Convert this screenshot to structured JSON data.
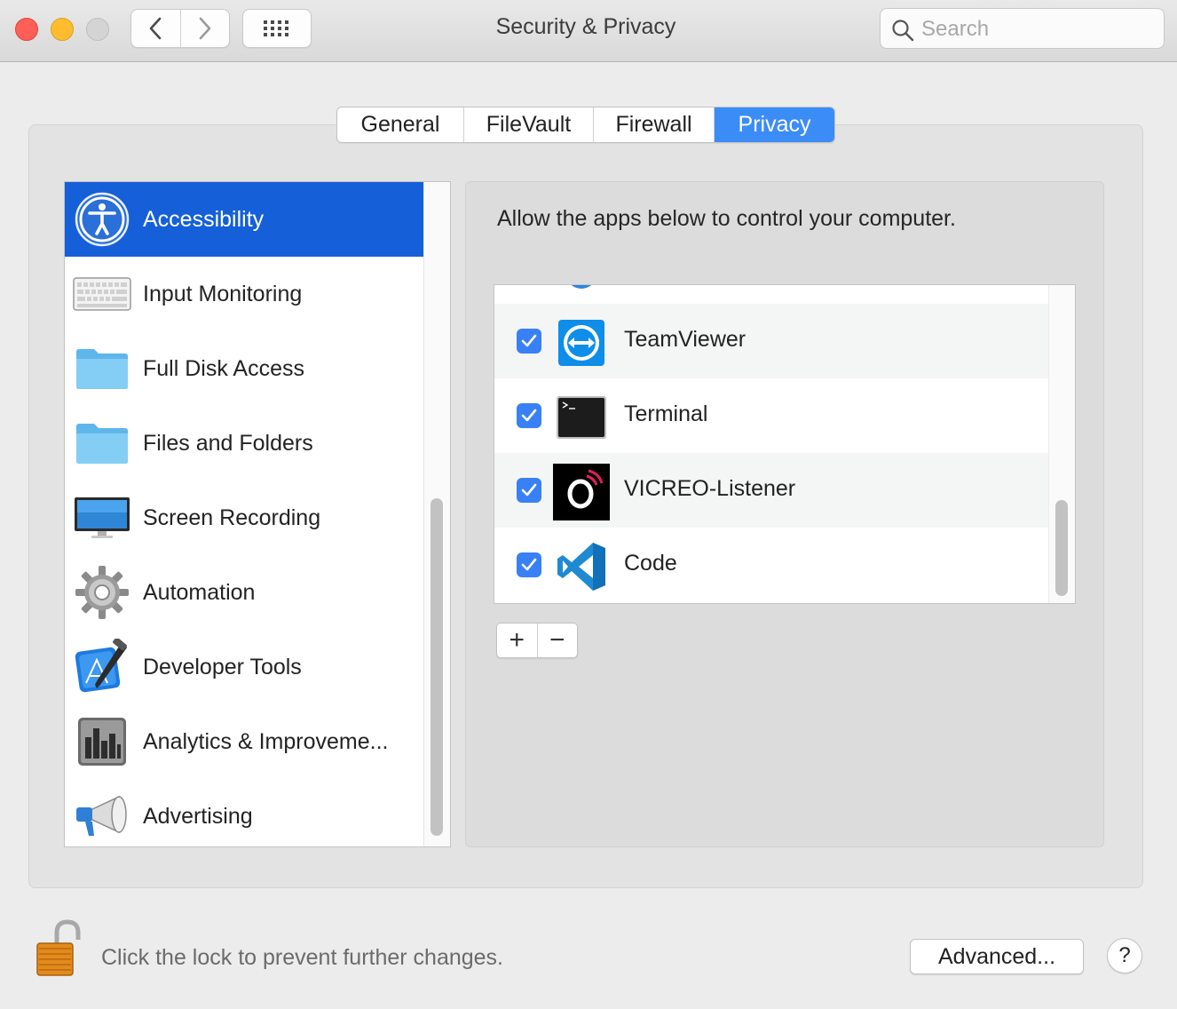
{
  "window": {
    "title": "Security & Privacy"
  },
  "toolbar": {
    "search_placeholder": "Search"
  },
  "tabs": [
    {
      "label": "General",
      "active": false
    },
    {
      "label": "FileVault",
      "active": false
    },
    {
      "label": "Firewall",
      "active": false
    },
    {
      "label": "Privacy",
      "active": true
    }
  ],
  "sidebar": {
    "items": [
      {
        "label": "Accessibility",
        "icon": "accessibility-icon",
        "selected": true
      },
      {
        "label": "Input Monitoring",
        "icon": "keyboard-icon"
      },
      {
        "label": "Full Disk Access",
        "icon": "folder-icon"
      },
      {
        "label": "Files and Folders",
        "icon": "folder-icon"
      },
      {
        "label": "Screen Recording",
        "icon": "display-icon"
      },
      {
        "label": "Automation",
        "icon": "gear-icon"
      },
      {
        "label": "Developer Tools",
        "icon": "xcode-icon"
      },
      {
        "label": "Analytics & Improveme...",
        "icon": "bar-chart-icon"
      },
      {
        "label": "Advertising",
        "icon": "megaphone-icon"
      }
    ]
  },
  "panel": {
    "instruction": "Allow the apps below to control your computer.",
    "apps": [
      {
        "name": "TeamViewer",
        "checked": true,
        "icon": "teamviewer-icon"
      },
      {
        "name": "Terminal",
        "checked": true,
        "icon": "terminal-icon"
      },
      {
        "name": "VICREO-Listener",
        "checked": true,
        "icon": "vicreo-icon"
      },
      {
        "name": "Code",
        "checked": true,
        "icon": "vscode-icon"
      }
    ],
    "add_label": "+",
    "remove_label": "−"
  },
  "footer": {
    "lock_message": "Click the lock to prevent further changes.",
    "advanced_label": "Advanced...",
    "help_label": "?"
  },
  "colors": {
    "accent": "#3b8cf7",
    "selection": "#1560d9",
    "checkbox": "#3880f5"
  }
}
